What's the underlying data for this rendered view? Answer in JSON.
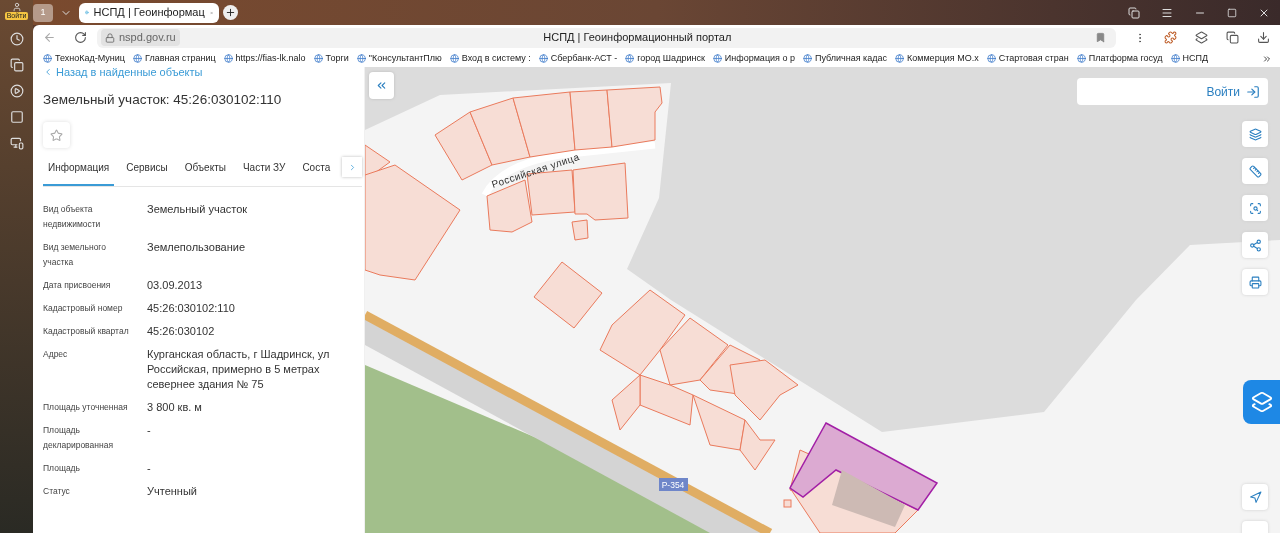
{
  "browser": {
    "profile_badge": "Войти",
    "tab_counter": "1",
    "tabs": [
      {
        "title": "НСПД | Геоинформац",
        "selected": true
      }
    ],
    "address": "nspd.gov.ru",
    "page_title": "НСПД | Геоинформационный портал",
    "bookmarks": [
      "ТехноКад-Муниц",
      "Главная страниц",
      "https://fias-lk.nalo",
      "Торги",
      "\"КонсультантПлю",
      "Вход в систему :",
      "Сбербанк-АСТ - ",
      "город Шадринск",
      "Информация о р",
      "Публичная кадас",
      "Коммерция МО.х",
      "Стартовая стран",
      "Платформа госуд",
      "НСПД"
    ]
  },
  "panel": {
    "back_link": "Назад в найденные объекты",
    "title": "Земельный участок: 45:26:030102:110",
    "tabs": [
      {
        "label": "Информация",
        "selected": true
      },
      {
        "label": "Сервисы",
        "selected": false
      },
      {
        "label": "Объекты",
        "selected": false
      },
      {
        "label": "Части ЗУ",
        "selected": false
      },
      {
        "label": "Соста",
        "selected": false
      }
    ],
    "fields": [
      {
        "label": "Вид объекта недвижимости",
        "value": "Земельный участок"
      },
      {
        "label": "Вид земельного участка",
        "value": "Землепользование"
      },
      {
        "label": "Дата присвоения",
        "value": "03.09.2013"
      },
      {
        "label": "Кадастровый номер",
        "value": "45:26:030102:110"
      },
      {
        "label": "Кадастровый квартал",
        "value": "45:26:030102"
      },
      {
        "label": "Адрес",
        "value": "Курганская область, г Шадринск, ул Российская, примерно в 5 метрах севернее здания № 75"
      },
      {
        "label": "Площадь уточненная",
        "value": "3 800 кв. м"
      },
      {
        "label": "Площадь декларированная",
        "value": "-"
      },
      {
        "label": "Площадь",
        "value": "-"
      },
      {
        "label": "Статус",
        "value": "Учтенный"
      }
    ]
  },
  "map": {
    "login_button": "Войти",
    "street_label": "Российская улица",
    "road_label": "Р-354"
  }
}
